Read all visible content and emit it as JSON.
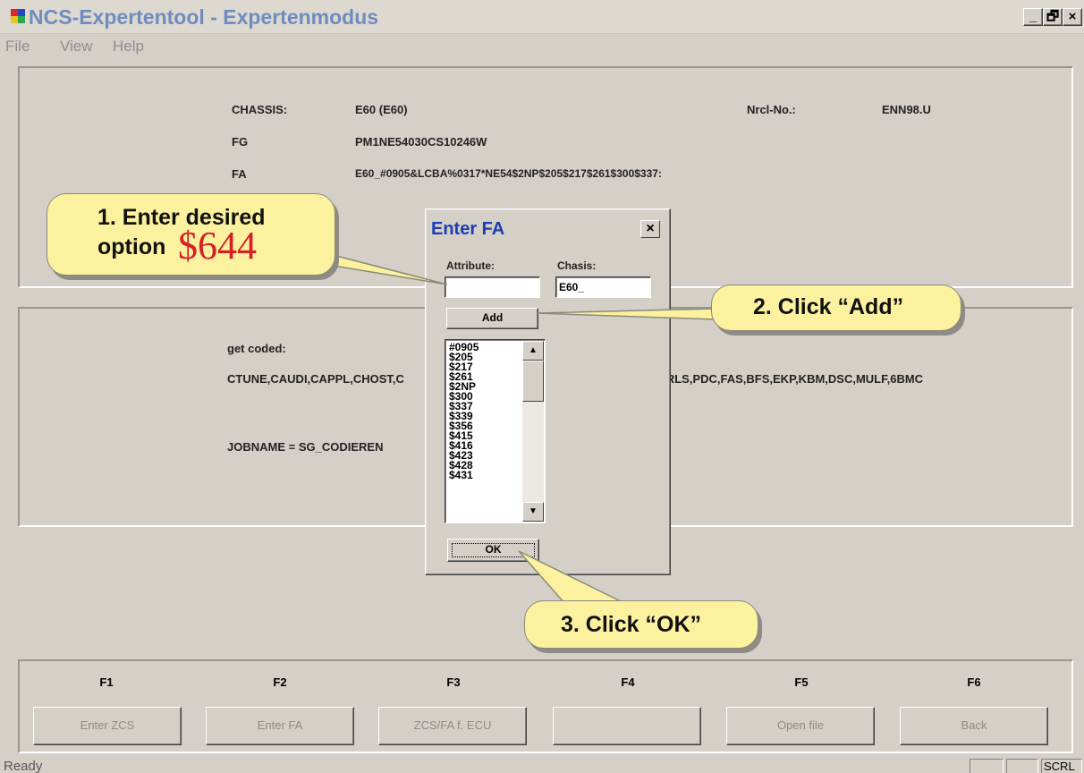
{
  "window": {
    "title": "NCS-Expertentool - Expertenmodus",
    "minimize_label": "_",
    "restore_label": "🗗",
    "close_label": "×"
  },
  "menu": [
    "File",
    "View",
    "Help"
  ],
  "vehicle_info": {
    "chassis_label": "CHASSIS:",
    "chassis_value": "E60 (E60)",
    "nrcl_label": "Nrcl-No.:",
    "nrcl_value": "ENN98.U",
    "fg_label": "FG",
    "fg_value": "PM1NE54030CS10246W",
    "fa_label": "FA",
    "fa_value": "E60_#0905&LCBA%0317*NE54$2NP$205$217$261$300$337:"
  },
  "coding": {
    "get_coded_label": "get coded:",
    "modules_left": "CTUNE,CAUDI,CAPPL,CHOST,C",
    "modules_right": ".FS,RLS,PDC,FAS,BFS,EKP,KBM,DSC,MULF,6BMC",
    "jobname": "JOBNAME = SG_CODIEREN"
  },
  "dialog": {
    "title": "Enter FA",
    "close_label": "×",
    "attribute_label": "Attribute:",
    "attribute_value": "",
    "chasis_label": "Chasis:",
    "chasis_value": "E60_",
    "add_label": "Add",
    "ok_label": "OK",
    "options": [
      "#0905",
      "$205",
      "$217",
      "$261",
      "$2NP",
      "$300",
      "$337",
      "$339",
      "$356",
      "$415",
      "$416",
      "$423",
      "$428",
      "$431"
    ],
    "scroll_up": "▲",
    "scroll_down": "▼"
  },
  "callouts": {
    "step1_line1": "1. Enter desired",
    "step1_line2": "option",
    "step1_value": "$644",
    "step2": "2. Click “Add”",
    "step3": "3. Click “OK”"
  },
  "function_keys": [
    {
      "key": "F1",
      "label": "Enter ZCS"
    },
    {
      "key": "F2",
      "label": "Enter FA"
    },
    {
      "key": "F3",
      "label": "ZCS/FA f. ECU"
    },
    {
      "key": "F4",
      "label": ""
    },
    {
      "key": "F5",
      "label": "Open file"
    },
    {
      "key": "F6",
      "label": "Back"
    }
  ],
  "status": {
    "text": "Ready",
    "indicator": "SCRL"
  },
  "colors": {
    "title_text": "#6f8cbd",
    "dialog_title": "#1c3eb2",
    "callout_fill": "#fbf19e",
    "highlight_red": "#d61f26"
  }
}
